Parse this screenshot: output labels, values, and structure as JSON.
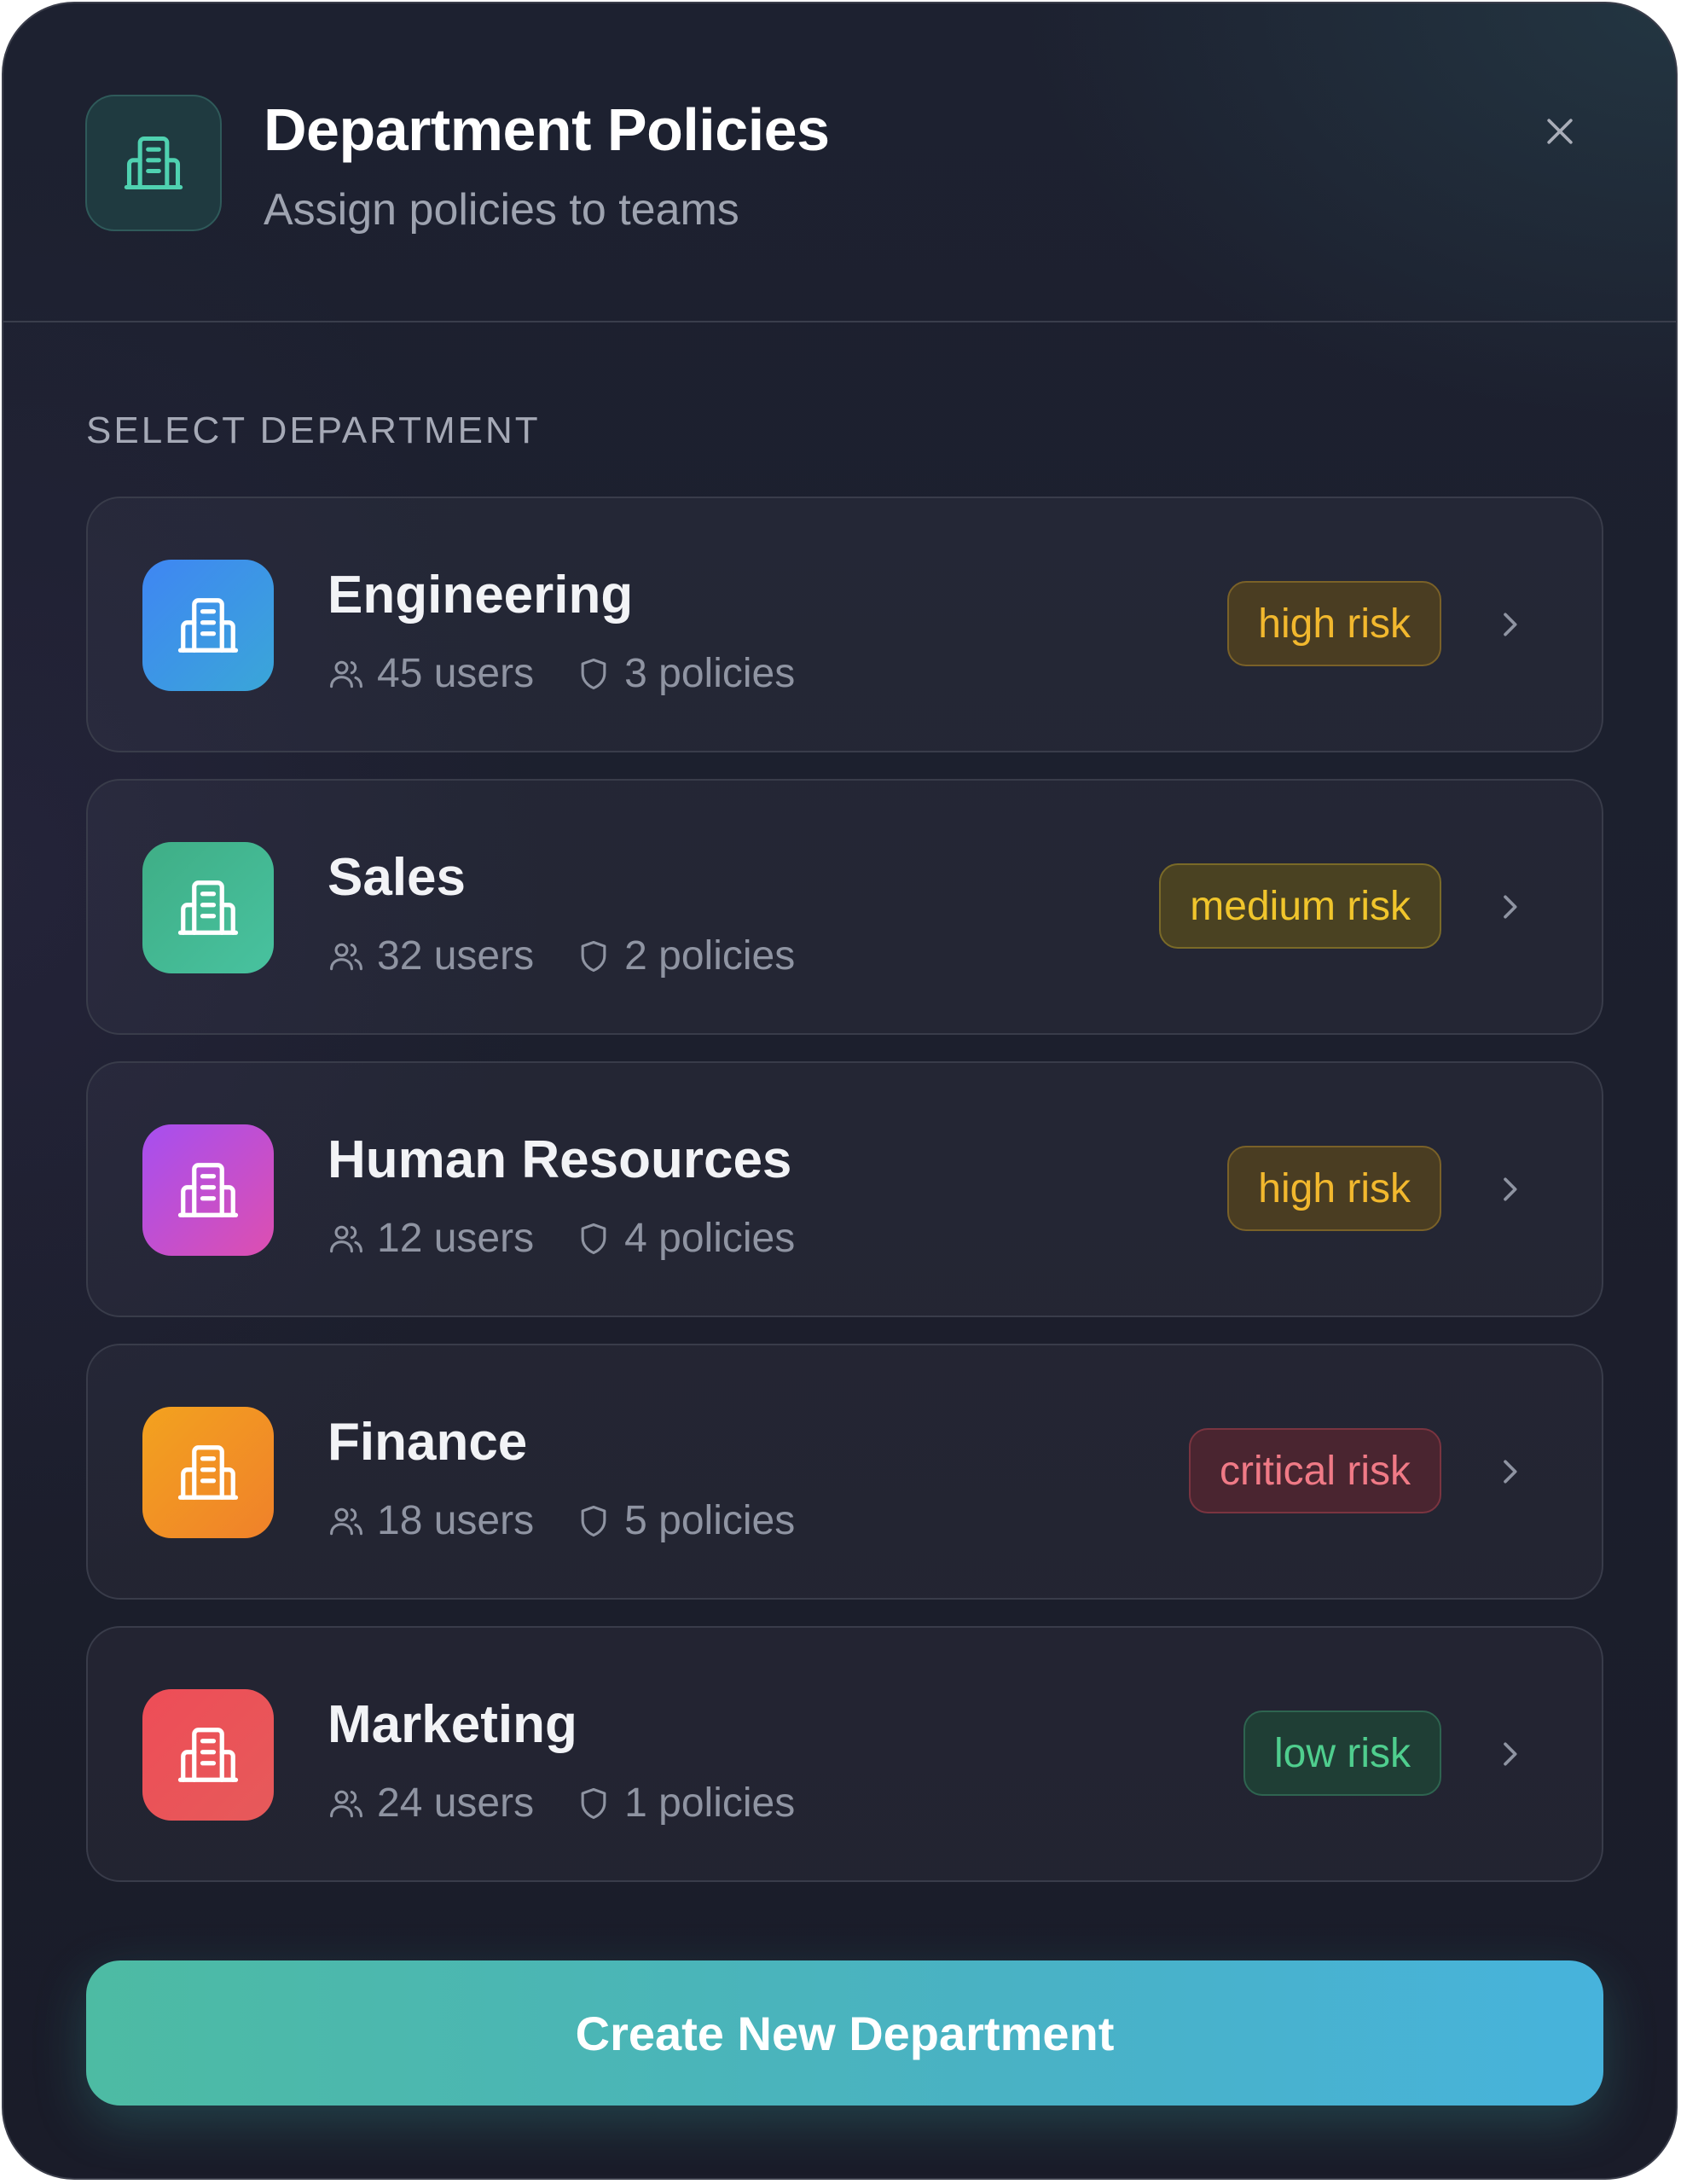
{
  "header": {
    "title": "Department Policies",
    "subtitle": "Assign policies to teams",
    "icon": "building-icon",
    "close_icon": "close-icon"
  },
  "section_label": "SELECT DEPARTMENT",
  "departments": [
    {
      "name": "Engineering",
      "users": "45 users",
      "policies": "3 policies",
      "risk": "high risk",
      "risk_level": "high",
      "icon_gradient": [
        "#3f86f3",
        "#3aa6d8"
      ],
      "badge_text_color": "#f2b82e",
      "badge_bg": "#4a3d22",
      "badge_border": "#7a6128"
    },
    {
      "name": "Sales",
      "users": "32 users",
      "policies": "2 policies",
      "risk": "medium risk",
      "risk_level": "medium",
      "icon_gradient": [
        "#3fae86",
        "#48c29f"
      ],
      "badge_text_color": "#f0c52c",
      "badge_bg": "#4a4222",
      "badge_border": "#7a6a28"
    },
    {
      "name": "Human Resources",
      "users": "12 users",
      "policies": "4 policies",
      "risk": "high risk",
      "risk_level": "high",
      "icon_gradient": [
        "#a64ff0",
        "#dd4fb0"
      ],
      "badge_text_color": "#f2b82e",
      "badge_bg": "#4a3d22",
      "badge_border": "#7a6128"
    },
    {
      "name": "Finance",
      "users": "18 users",
      "policies": "5 policies",
      "risk": "critical risk",
      "risk_level": "critical",
      "icon_gradient": [
        "#f3a21f",
        "#f0812a"
      ],
      "badge_text_color": "#f07a86",
      "badge_bg": "#4a2530",
      "badge_border": "#7a3440"
    },
    {
      "name": "Marketing",
      "users": "24 users",
      "policies": "1 policies",
      "risk": "low risk",
      "risk_level": "low",
      "icon_gradient": [
        "#ee4d57",
        "#e65a5a"
      ],
      "badge_text_color": "#4fce8e",
      "badge_bg": "#1f3e35",
      "badge_border": "#2e6450"
    }
  ],
  "create_button": "Create New Department",
  "colors": {
    "accent_start": "#4dbba3",
    "accent_end": "#47b3dc",
    "panel_bg": "#1c1f2d"
  }
}
